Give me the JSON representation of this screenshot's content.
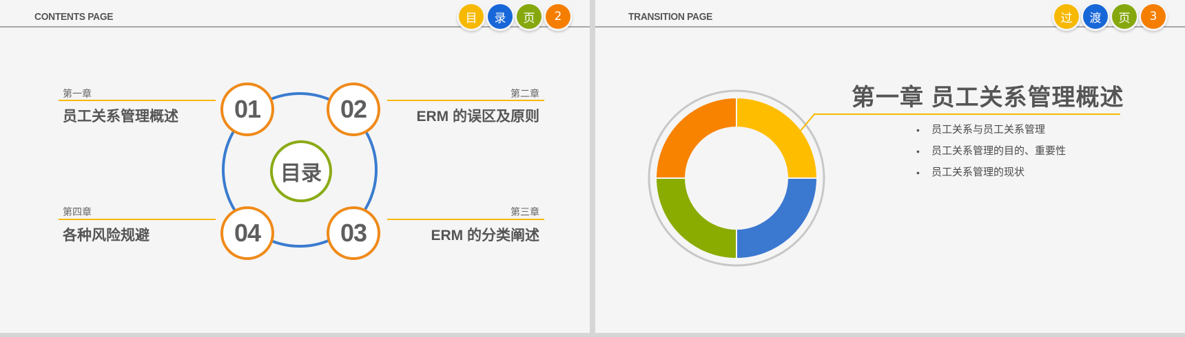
{
  "slide1": {
    "header": "CONTENTS PAGE",
    "tabs": [
      "目",
      "录",
      "页",
      "2"
    ],
    "center_label": "目录",
    "chapters": [
      {
        "number": "01",
        "label": "第一章",
        "title": "员工关系管理概述"
      },
      {
        "number": "02",
        "label": "第二章",
        "title": "ERM 的误区及原则"
      },
      {
        "number": "03",
        "label": "第三章",
        "title": "ERM 的分类阐述"
      },
      {
        "number": "04",
        "label": "第四章",
        "title": "各种风险规避"
      }
    ]
  },
  "slide2": {
    "header": "TRANSITION  PAGE",
    "tabs": [
      "过",
      "渡",
      "页",
      "3"
    ],
    "title": "第一章  员工关系管理概述",
    "bullets": [
      "员工关系与员工关系管理",
      "员工关系管理的目的、重要性",
      "员工关系管理的现状"
    ],
    "donut": {
      "segments": [
        {
          "value": 25,
          "color": "#ffbd00"
        },
        {
          "value": 25,
          "color": "#3b78d0"
        },
        {
          "value": 25,
          "color": "#8aab00"
        },
        {
          "value": 25,
          "color": "#f88300"
        }
      ]
    }
  },
  "colors": {
    "yellow": "#f7b800",
    "blue": "#1767d8",
    "green": "#86a80e",
    "orange": "#f57e00"
  }
}
